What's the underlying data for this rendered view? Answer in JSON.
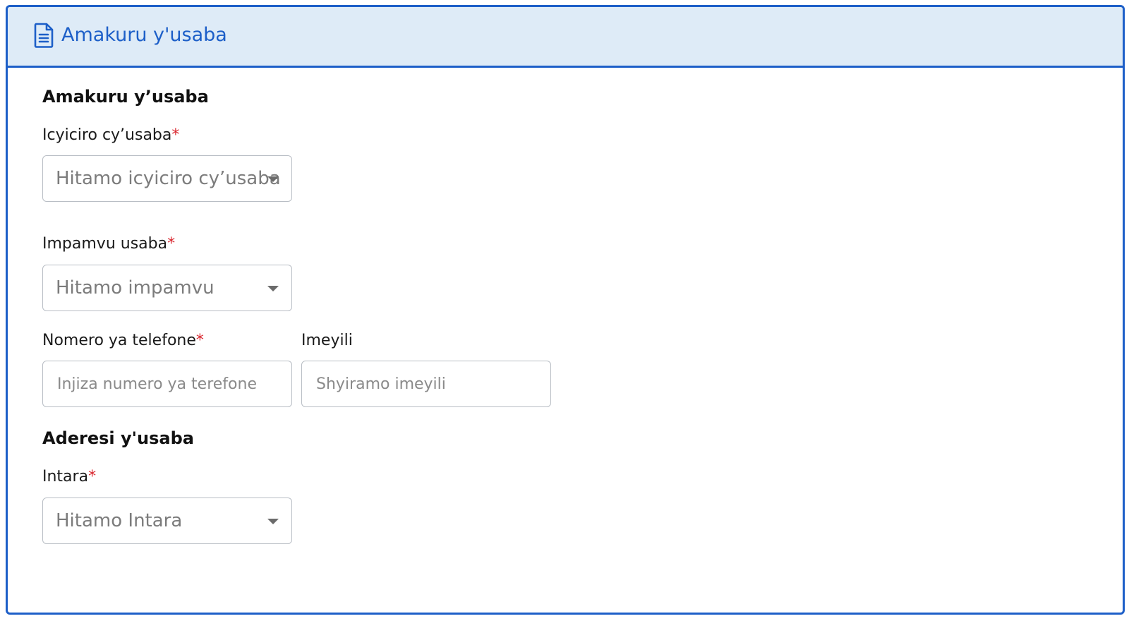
{
  "header": {
    "title": "Amakuru y'usaba",
    "icon": "document-icon"
  },
  "sections": {
    "applicant_info": "Amakuru y’usaba",
    "address": "Aderesi y'usaba"
  },
  "fields": {
    "applicant_category": {
      "label": "Icyiciro cy’usaba",
      "required_mark": "*",
      "placeholder": "Hitamo icyiciro cy’usaba"
    },
    "reason": {
      "label": "Impamvu usaba",
      "required_mark": "*",
      "placeholder": "Hitamo impamvu"
    },
    "phone": {
      "label": "Nomero ya telefone",
      "required_mark": "*",
      "placeholder": "Injiza numero ya terefone",
      "value": ""
    },
    "email": {
      "label": "Imeyili",
      "placeholder": "Shyiramo imeyili",
      "value": ""
    },
    "province": {
      "label": "Intara",
      "required_mark": "*",
      "placeholder": "Hitamo Intara"
    }
  },
  "colors": {
    "accent": "#1d5fc8",
    "header_bg": "#deebf7",
    "required": "#d9262e",
    "border": "#b9bec5",
    "placeholder": "#7c7c7c"
  }
}
